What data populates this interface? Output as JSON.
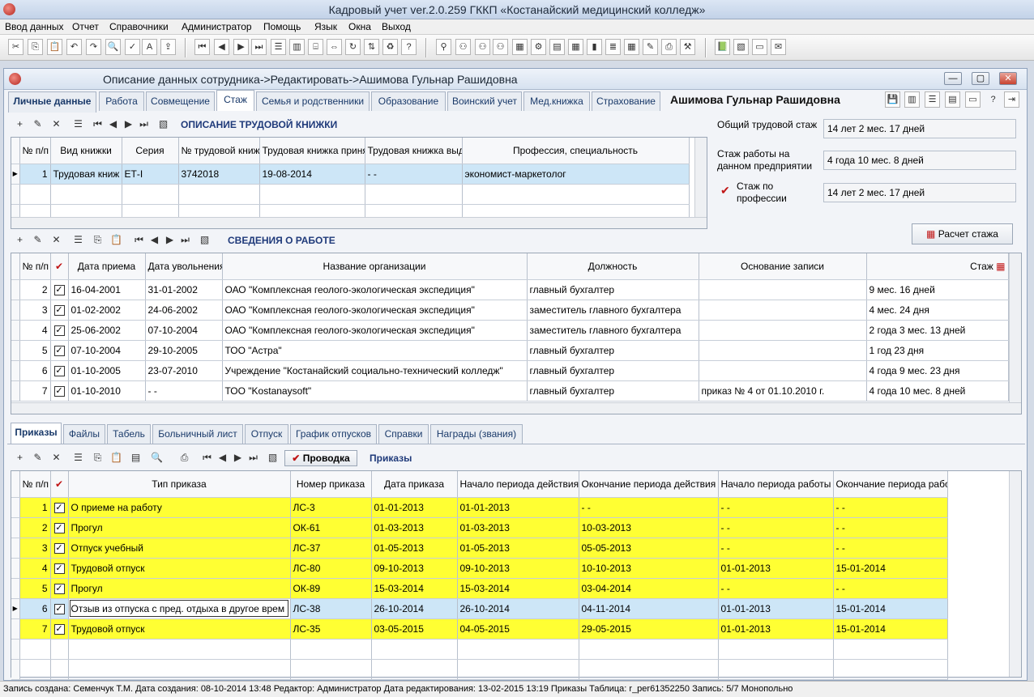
{
  "app_title": "Кадровый учет ver.2.0.259 ГККП «Костанайский медицинский колледж»",
  "menu": [
    "Ввод данных",
    "Отчет",
    "Справочники",
    "Администратор",
    "Помощь",
    "Язык",
    "Окна",
    "Выход"
  ],
  "window_title": "Описание данных сотрудника->Редактировать->Ашимова Гульнар Рашидовна",
  "employee_name": "Ашимова Гульнар Рашидовна",
  "main_tabs": [
    "Личные данные",
    "Работа",
    "Совмещение",
    "Стаж",
    "Семья и родственники",
    "Образование",
    "Воинский учет",
    "Мед.книжка",
    "Страхование"
  ],
  "book_section": {
    "title": "ОПИСАНИЕ ТРУДОВОЙ КНИЖКИ",
    "headers": [
      "№ п/п",
      "Вид книжки",
      "Серия",
      "№ трудовой книжки",
      "Трудовая книжка принята",
      "Трудовая книжка выдана",
      "Профессия, специальность"
    ],
    "rows": [
      [
        "1",
        "Трудовая книж",
        "ЕТ-I",
        "3742018",
        "19-08-2014",
        "- -",
        "экономист-маркетолог"
      ]
    ]
  },
  "summary": {
    "total_label": "Общий трудовой стаж",
    "total_value": "14 лет 2 мес. 17 дней",
    "company_label": "Стаж работы на данном предприятии",
    "company_value": "4 года 10 мес. 8 дней",
    "prof_label": "Стаж по профессии",
    "prof_value": "14 лет 2 мес. 17 дней",
    "calc_button": "Расчет стажа"
  },
  "work_section": {
    "title": "СВЕДЕНИЯ О РАБОТЕ",
    "headers": [
      "№ п/п",
      "",
      "Дата приема",
      "Дата увольнения",
      "Название организации",
      "Должность",
      "Основание записи",
      "Стаж"
    ],
    "rows": [
      [
        "2",
        "16-04-2001",
        "31-01-2002",
        "ОАО \"Комплексная геолого-экологическая экспедиция\"",
        "главный бухгалтер",
        "",
        "9 мес. 16 дней"
      ],
      [
        "3",
        "01-02-2002",
        "24-06-2002",
        "ОАО \"Комплексная геолого-экологическая экспедиция\"",
        "заместитель главного бухгалтера",
        "",
        "4 мес. 24 дня"
      ],
      [
        "4",
        "25-06-2002",
        "07-10-2004",
        "ОАО \"Комплексная геолого-экологическая экспедиция\"",
        "заместитель главного бухгалтера",
        "",
        "2 года 3 мес. 13 дней"
      ],
      [
        "5",
        "07-10-2004",
        "29-10-2005",
        "ТОО \"Астра\"",
        "главный бухгалтер",
        "",
        "1 год 23 дня"
      ],
      [
        "6",
        "01-10-2005",
        "23-07-2010",
        "Учреждение \"Костанайский социально-технический колледж\"",
        "главный бухгалтер",
        "",
        "4 года 9 мес. 23 дня"
      ],
      [
        "7",
        "01-10-2010",
        "- -",
        "ТОО \"Kostanaysoft\"",
        "главный бухгалтер",
        "приказ № 4 от 01.10.2010 г.",
        "4 года 10 мес. 8 дней"
      ]
    ]
  },
  "bottom_tabs": [
    "Приказы",
    "Файлы",
    "Табель",
    "Больничный лист",
    "Отпуск",
    "График отпусков",
    "Справки",
    "Награды (звания)"
  ],
  "orders_section": {
    "title": "Приказы",
    "provodka_button": "Проводка",
    "headers": [
      "№ п/п",
      "",
      "Тип приказа",
      "Номер приказа",
      "Дата приказа",
      "Начало периода действия",
      "Окончание периода действия",
      "Начало периода работы",
      "Окончание периода работы"
    ],
    "rows": [
      [
        "1",
        "О приеме на работу",
        "ЛС-3",
        "01-01-2013",
        "01-01-2013",
        "- -",
        "- -",
        "- -"
      ],
      [
        "2",
        "Прогул",
        "ОК-61",
        "01-03-2013",
        "01-03-2013",
        "10-03-2013",
        "- -",
        "- -"
      ],
      [
        "3",
        "Отпуск учебный",
        "ЛС-37",
        "01-05-2013",
        "01-05-2013",
        "05-05-2013",
        "- -",
        "- -"
      ],
      [
        "4",
        "Трудовой отпуск",
        "ЛС-80",
        "09-10-2013",
        "09-10-2013",
        "10-10-2013",
        "01-01-2013",
        "15-01-2014"
      ],
      [
        "5",
        "Прогул",
        "ОК-89",
        "15-03-2014",
        "15-03-2014",
        "03-04-2014",
        "- -",
        "- -"
      ],
      [
        "6",
        "Отзыв из отпуска с пред. отдыха в другое врем",
        "ЛС-38",
        "26-10-2014",
        "26-10-2014",
        "04-11-2014",
        "01-01-2013",
        "15-01-2014"
      ],
      [
        "7",
        "Трудовой отпуск",
        "ЛС-35",
        "03-05-2015",
        "04-05-2015",
        "29-05-2015",
        "01-01-2013",
        "15-01-2014"
      ]
    ],
    "selected_row": "6"
  },
  "status_bar": "Запись создана: Семенчук Т.М.  Дата создания: 08-10-2014 13:48  Редактор: Администратор  Дата редактирования: 13-02-2015 13:19  Приказы  Таблица: r_per61352250  Запись: 5/7  Монопольно"
}
